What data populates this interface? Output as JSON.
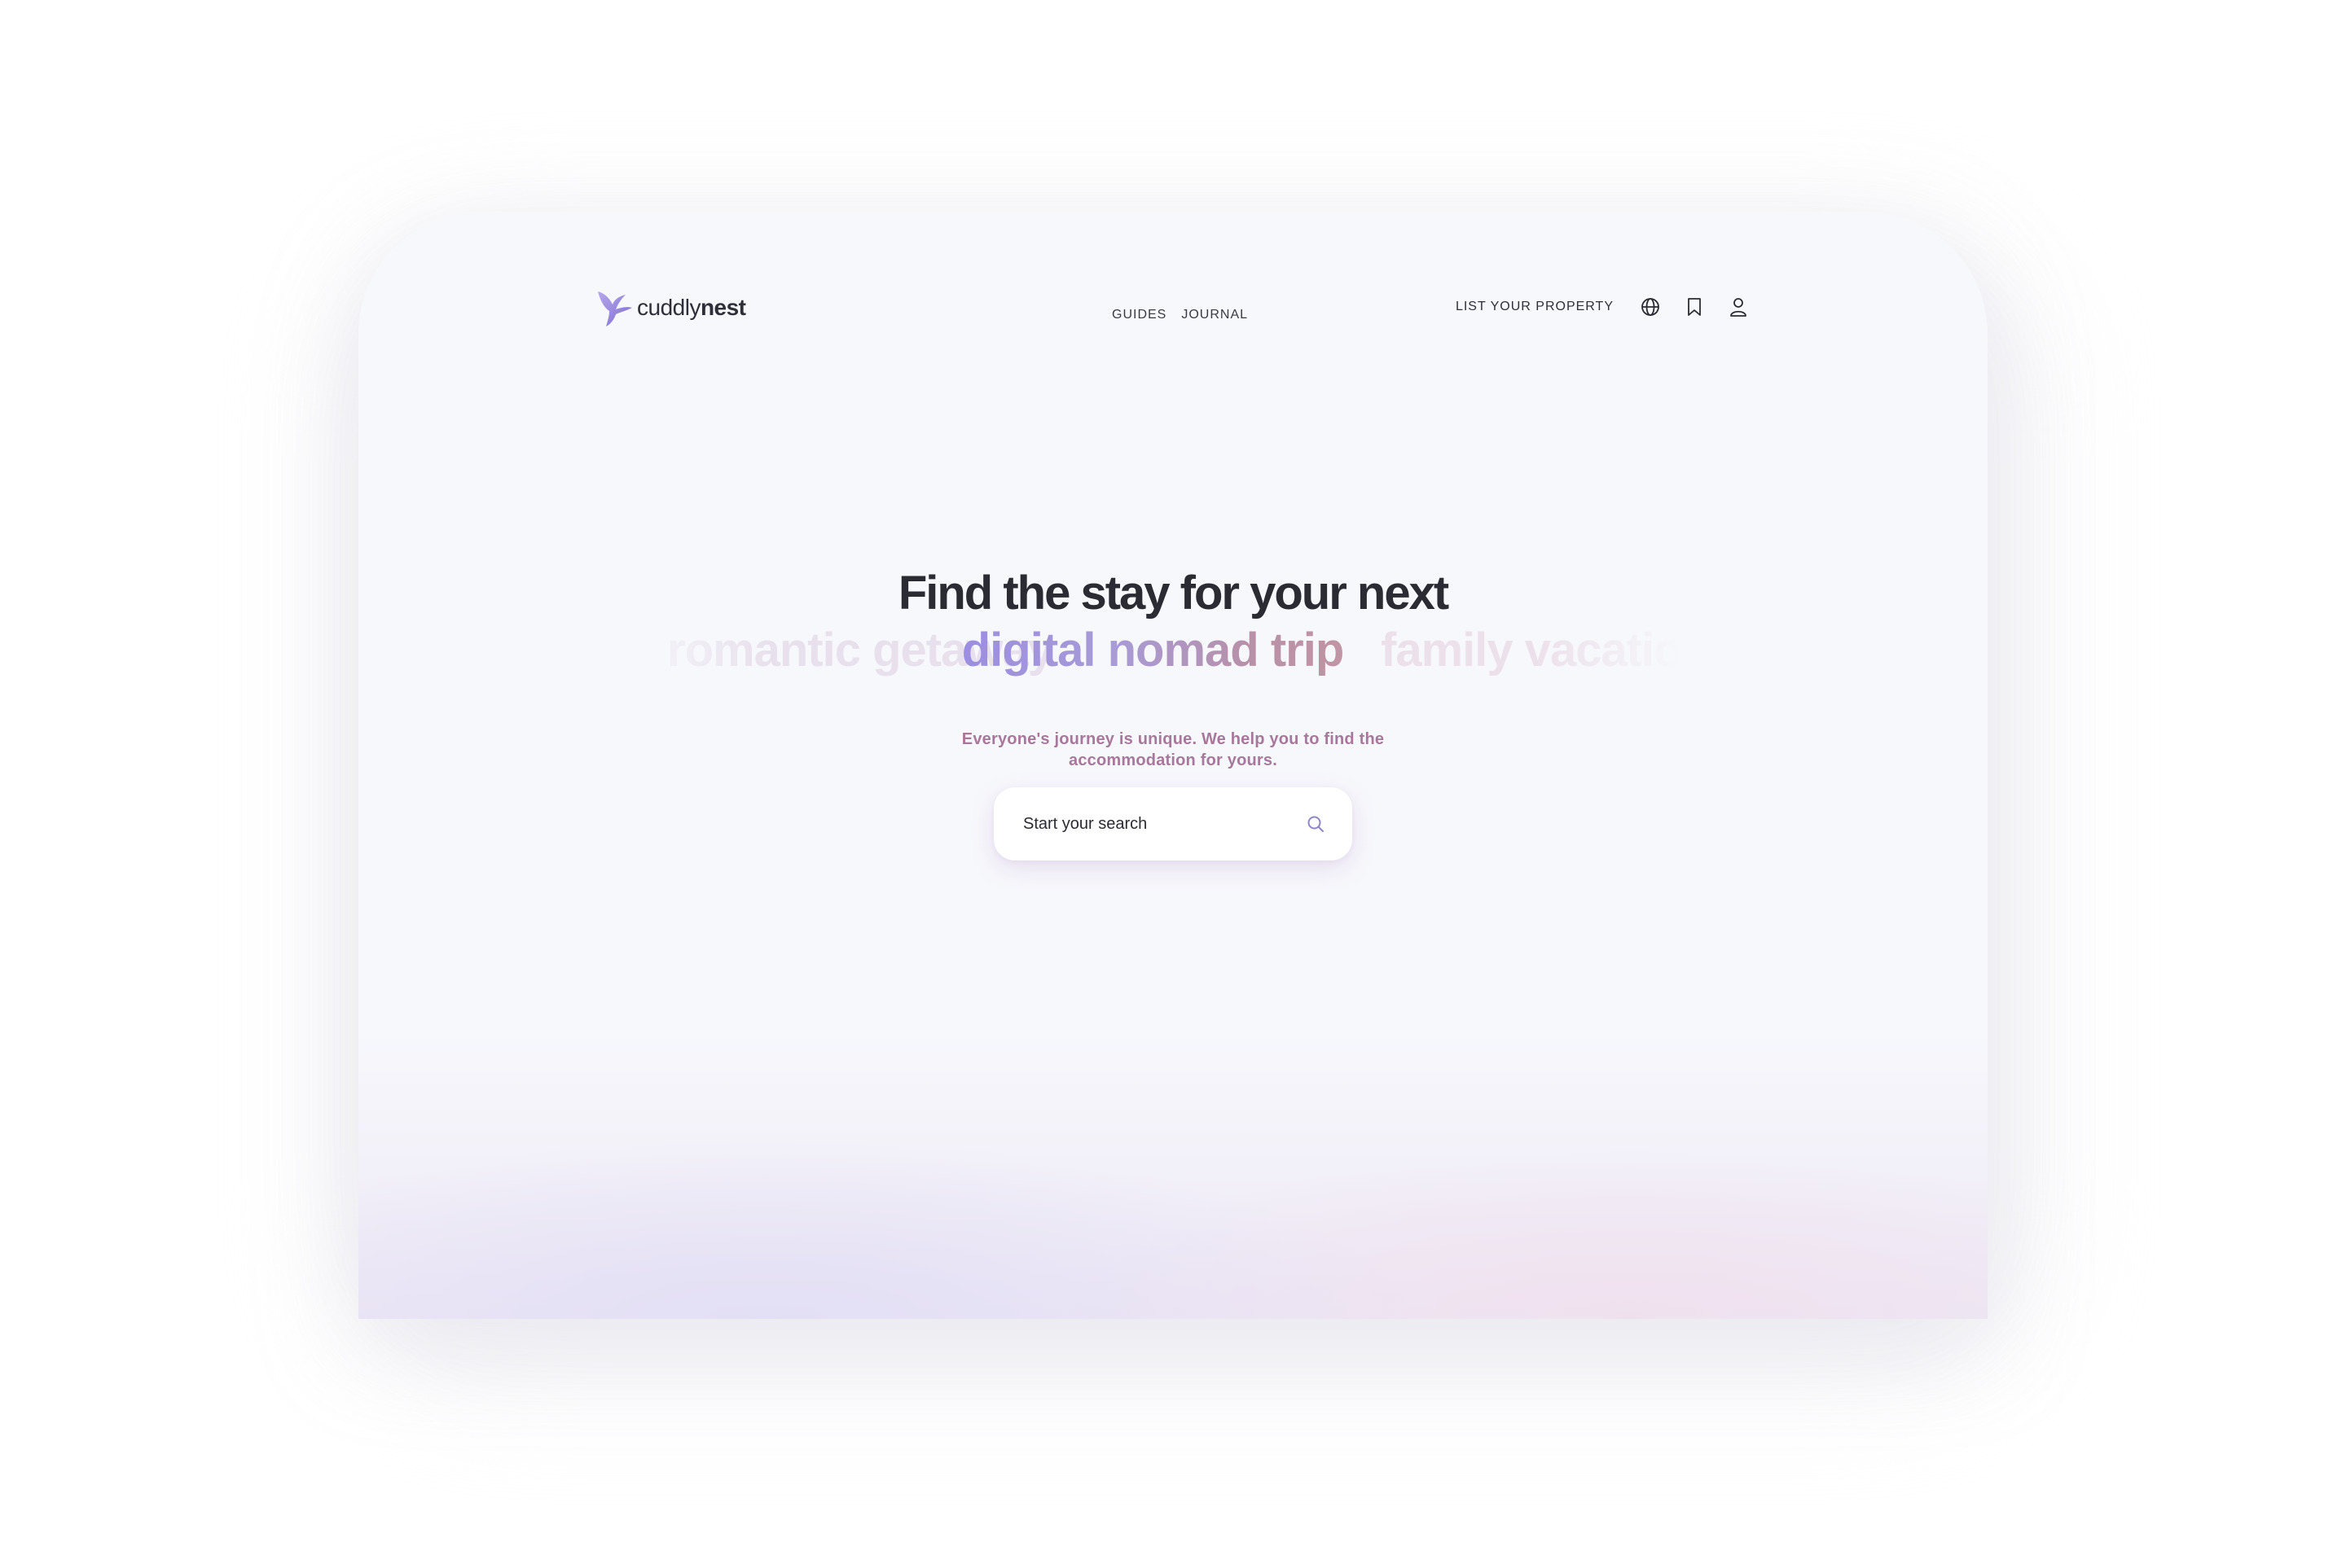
{
  "brand": {
    "logo_text_light": "cuddly",
    "logo_text_bold": "nest",
    "logo_icon": "hummingbird-icon",
    "accent_color": "#9c8ee0",
    "secondary_color": "#b890a8"
  },
  "nav": {
    "center_links": [
      "GUIDES",
      "JOURNAL"
    ],
    "list_property_label": "LIST YOUR PROPERTY",
    "icons": [
      "globe-icon",
      "bookmark-icon",
      "user-icon"
    ]
  },
  "hero": {
    "title": "Find the stay for your next",
    "phrases": {
      "left": "romantic getaway",
      "active": "digital nomad trip",
      "right": "family vacation"
    },
    "subtitle_line1": "Everyone's journey is unique. We help you to find the",
    "subtitle_line2": "accommodation for yours."
  },
  "search": {
    "placeholder": "Start your search",
    "icon": "search-icon"
  }
}
